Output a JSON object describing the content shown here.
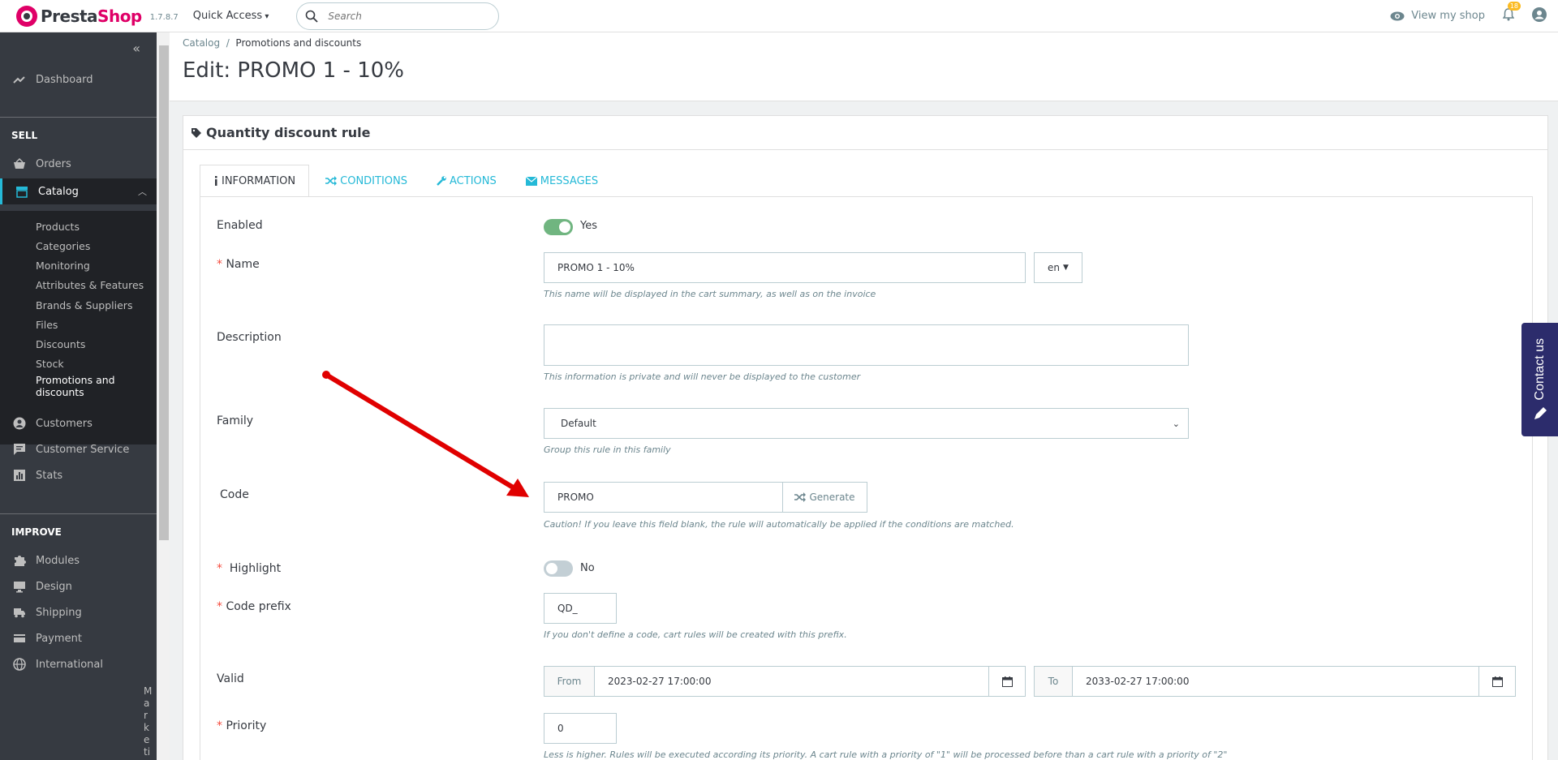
{
  "header": {
    "logo_prefix": "Presta",
    "logo_suffix": "Shop",
    "version": "1.7.8.7",
    "quick_access": "Quick Access",
    "search_placeholder": "Search",
    "view_shop": "View my shop",
    "notif_count": "18"
  },
  "sidebar": {
    "dashboard": "Dashboard",
    "sell_title": "SELL",
    "orders": "Orders",
    "catalog": "Catalog",
    "catalog_sub": [
      "Products",
      "Categories",
      "Monitoring",
      "Attributes & Features",
      "Brands & Suppliers",
      "Files",
      "Discounts",
      "Stock",
      "Promotions and",
      "discounts"
    ],
    "customers": "Customers",
    "customer_service": "Customer Service",
    "stats": "Stats",
    "improve_title": "IMPROVE",
    "modules": "Modules",
    "design": "Design",
    "shipping": "Shipping",
    "payment": "Payment",
    "international": "International",
    "marketing": "Marketin"
  },
  "breadcrumb": {
    "parent": "Catalog",
    "separator": "/",
    "current": "Promotions and discounts"
  },
  "page_title": "Edit: PROMO 1 - 10%",
  "panel_title": "Quantity discount rule",
  "tabs": [
    "INFORMATION",
    "CONDITIONS",
    "ACTIONS",
    "MESSAGES"
  ],
  "form": {
    "enabled_label": "Enabled",
    "enabled_value": "Yes",
    "name_label": "Name",
    "name_value": "PROMO 1 - 10%",
    "lang": "en",
    "name_help": "This name will be displayed in the cart summary, as well as on the invoice",
    "description_label": "Description",
    "description_help": "This information is private and will never be displayed to the customer",
    "family_label": "Family",
    "family_value": "Default",
    "family_help": "Group this rule in this family",
    "code_label": "Code",
    "code_value": "PROMO",
    "generate": "Generate",
    "code_help": "Caution! If you leave this field blank, the rule will automatically be applied if the conditions are matched.",
    "highlight_label": "Highlight",
    "highlight_value": "No",
    "prefix_label": "Code prefix",
    "prefix_value": "QD_",
    "prefix_help": "If you don't define a code, cart rules will be created with this prefix.",
    "valid_label": "Valid",
    "from_label": "From",
    "from_value": "2023-02-27 17:00:00",
    "to_label": "To",
    "to_value": "2033-02-27 17:00:00",
    "priority_label": "Priority",
    "priority_value": "0",
    "priority_help": "Less is higher. Rules will be executed according its priority. A cart rule with a priority of \"1\" will be processed before than a cart rule with a priority of \"2\""
  },
  "contact": "Contact us",
  "colors": {
    "accent": "#25b9d7",
    "brand": "#df0067",
    "sidebar": "#363a41",
    "switch_on": "#70b580",
    "arrow": "#e00000"
  }
}
